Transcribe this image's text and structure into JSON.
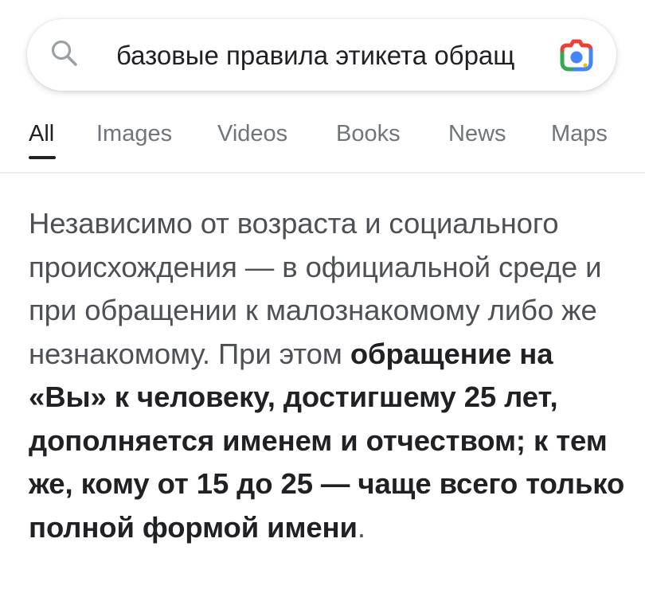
{
  "search": {
    "query": "базовые правила этикета обращ",
    "search_icon": "search-icon",
    "lens_icon": "google-lens-icon",
    "colors": {
      "lens_blue": "#4285f4",
      "lens_red": "#ea4335",
      "lens_yellow": "#fbbc04",
      "lens_green": "#34a853"
    }
  },
  "tabs": [
    {
      "label": "All",
      "active": true
    },
    {
      "label": "Images",
      "active": false
    },
    {
      "label": "Videos",
      "active": false
    },
    {
      "label": "Books",
      "active": false
    },
    {
      "label": "News",
      "active": false
    },
    {
      "label": "Maps",
      "active": false
    }
  ],
  "snippet": {
    "plain_1": "Независимо от возраста и социального происхождения — в официальной среде и при обращении к малознакомому либо же незнакомому. При этом ",
    "bold_1": "обращение на «Вы» к человеку, достигшему 25 лет, дополняется именем и отчеством; к тем же, кому от 15 до 25 — чаще всего только полной формой имени",
    "plain_2": "."
  }
}
